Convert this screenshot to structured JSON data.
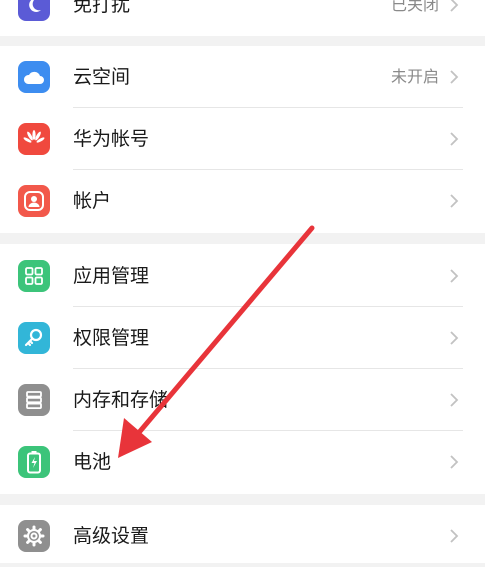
{
  "groups": [
    {
      "items": [
        {
          "label": "免打扰",
          "value": "已关闭",
          "icon": "moon-icon",
          "color": "#5b5bd6"
        }
      ]
    },
    {
      "items": [
        {
          "label": "云空间",
          "value": "未开启",
          "icon": "cloud-icon",
          "color": "#3d8df0"
        },
        {
          "label": "华为帐号",
          "value": "",
          "icon": "huawei-logo-icon",
          "color": "#f0493e"
        },
        {
          "label": "帐户",
          "value": "",
          "icon": "user-icon",
          "color": "#f2584b"
        }
      ]
    },
    {
      "items": [
        {
          "label": "应用管理",
          "value": "",
          "icon": "apps-grid-icon",
          "color": "#3cc47a"
        },
        {
          "label": "权限管理",
          "value": "",
          "icon": "key-icon",
          "color": "#32b6d8"
        },
        {
          "label": "内存和存储",
          "value": "",
          "icon": "storage-icon",
          "color": "#8f8f8f"
        },
        {
          "label": "电池",
          "value": "",
          "icon": "battery-icon",
          "color": "#3cc47a"
        }
      ]
    },
    {
      "items": [
        {
          "label": "高级设置",
          "value": "",
          "icon": "gear-icon",
          "color": "#8f8f8f"
        }
      ]
    }
  ],
  "annotation": {
    "color": "#e8343a"
  }
}
